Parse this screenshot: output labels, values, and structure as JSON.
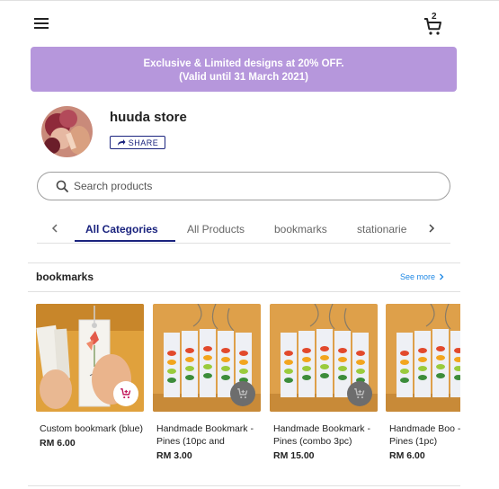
{
  "header": {
    "cart_count": "2"
  },
  "banner": {
    "line1": "Exclusive & Limited designs at 20% OFF.",
    "line2": "(Valid until 31 March 2021)"
  },
  "store": {
    "name": "huuda store",
    "share_label": "SHARE"
  },
  "search": {
    "placeholder": "Search products"
  },
  "tabs": [
    {
      "label": "All Categories",
      "active": true
    },
    {
      "label": "All Products",
      "active": false
    },
    {
      "label": "bookmarks",
      "active": false
    },
    {
      "label": "stationarie",
      "active": false
    }
  ],
  "section": {
    "title": "bookmarks",
    "see_more": "See more"
  },
  "products": [
    {
      "name": "Custom bookmark (blue)",
      "price": "RM 6.00"
    },
    {
      "name": "Handmade Bookmark - Pines (10pc and",
      "price": "RM 3.00"
    },
    {
      "name": "Handmade Bookmark - Pines (combo 3pc)",
      "price": "RM 15.00"
    },
    {
      "name": "Handmade Boo - Pines (1pc)",
      "price": "RM 6.00"
    }
  ],
  "colors": {
    "banner": "#b697dc",
    "accent": "#1a237e",
    "link": "#1e88e5"
  }
}
